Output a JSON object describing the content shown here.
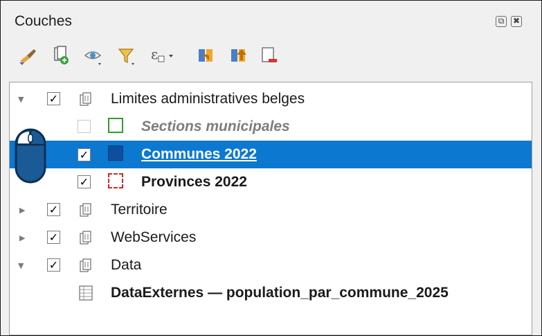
{
  "panel": {
    "title": "Couches"
  },
  "window_controls": [
    {
      "name": "float-icon",
      "glyph": "⧉"
    },
    {
      "name": "close-icon",
      "glyph": "✖"
    }
  ],
  "toolbar": {
    "buttons": [
      "style-manager-icon",
      "add-group-icon",
      "visibility-icon",
      "filter-legend-icon",
      "filter-expression-icon",
      "expand-all-icon",
      "collapse-all-icon",
      "remove-layer-icon"
    ]
  },
  "layers": [
    {
      "label": "Limites administratives belges",
      "type": "group",
      "expanded": true,
      "checked": true
    },
    {
      "label": "Sections municipales",
      "type": "layer",
      "checked": false,
      "style": "italic",
      "symbol_color": "#2ca02c"
    },
    {
      "label": "Communes 2022",
      "type": "layer",
      "checked": true,
      "style": "selected",
      "symbol_color": "#0d4f9e"
    },
    {
      "label": "Provinces 2022",
      "type": "layer",
      "checked": true,
      "style": "bold",
      "symbol_color": "#d62728"
    },
    {
      "label": "Territoire",
      "type": "group",
      "expanded": false,
      "checked": true
    },
    {
      "label": "WebServices",
      "type": "group",
      "expanded": false,
      "checked": true
    },
    {
      "label": "Data",
      "type": "group",
      "expanded": true,
      "checked": true
    },
    {
      "label": "DataExternes — population_par_commune_2025",
      "type": "table",
      "style": "bold"
    }
  ],
  "colors": {
    "selection": "#0d78d0",
    "panel_bg": "#f0f0f0"
  }
}
